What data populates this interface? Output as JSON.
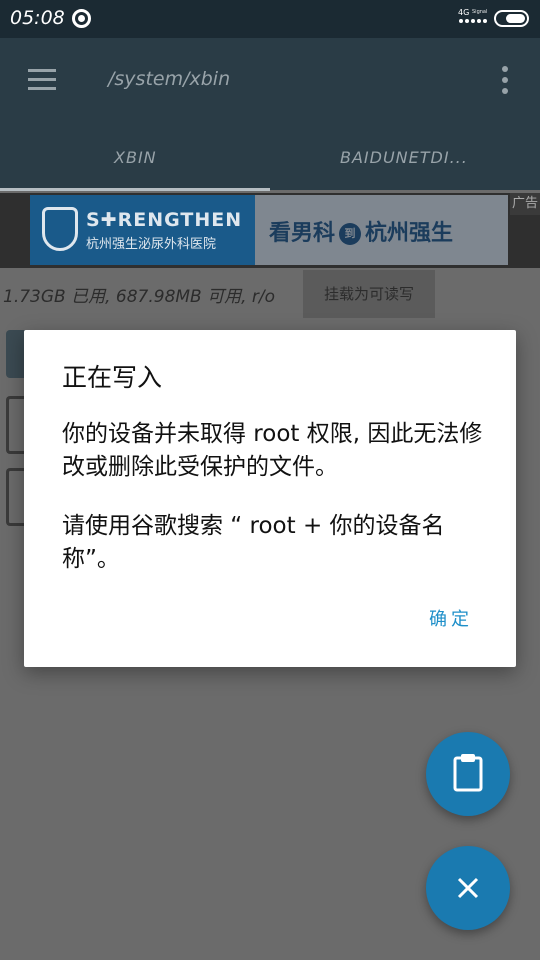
{
  "status_bar": {
    "time": "05:08",
    "network": "4G",
    "network_sub": "Signal",
    "app_icon": "netease-music-icon",
    "battery_icon": "battery-toggle-icon"
  },
  "app_bar": {
    "menu_icon": "hamburger-menu-icon",
    "path": "/system/xbin",
    "overflow_icon": "more-vert-icon",
    "tabs": [
      {
        "label": "XBIN"
      },
      {
        "label": "BAIDUNETDI..."
      }
    ]
  },
  "ad": {
    "logo_text": "S✚RENGTHEN",
    "logo_sub": "杭州强生泌尿外科医院",
    "slogan_left": "看男科",
    "slogan_mid": "到",
    "slogan_right": "杭州强生",
    "mark": "广告"
  },
  "storage": {
    "info": "1.73GB 已用, 687.98MB 可用, r/o",
    "mount_label": "挂载为可读写"
  },
  "dialog": {
    "title": "正在写入",
    "message_1": "你的设备并未取得 root 权限, 因此无法修改或删除此受保护的文件。",
    "message_2": "请使用谷歌搜索 “ root + 你的设备名称”。",
    "ok_label": "确定"
  },
  "fabs": {
    "paste_icon": "clipboard-icon",
    "close_icon": "close-icon"
  },
  "colors": {
    "accent": "#1e8fc9",
    "fab": "#1a7ab0",
    "status_bar": "#1b2a33",
    "app_bar": "#2a3c46"
  }
}
